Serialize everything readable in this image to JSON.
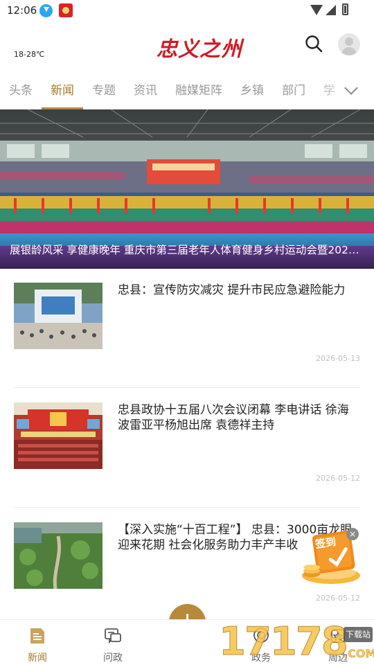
{
  "status_bar": {
    "time": "12:06",
    "icons": [
      "download-icon",
      "app-notification-icon",
      "wifi-icon",
      "signal-icon",
      "battery-icon"
    ]
  },
  "header": {
    "weather": "18-28℃",
    "logo_text": "忠义之州",
    "search_icon": "search-icon",
    "avatar_icon": "user-avatar-icon"
  },
  "tabs": {
    "items": [
      {
        "label": "头条",
        "active": false
      },
      {
        "label": "新闻",
        "active": true
      },
      {
        "label": "专题",
        "active": false
      },
      {
        "label": "资讯",
        "active": false
      },
      {
        "label": "融媒矩阵",
        "active": false
      },
      {
        "label": "乡镇",
        "active": false
      },
      {
        "label": "部门",
        "active": false
      },
      {
        "label": "学",
        "active": false
      }
    ],
    "more_icon": "chevron-down-icon",
    "active_color": "#a5782c"
  },
  "banner": {
    "caption": "展银龄风采 享健康晚年 重庆市第三届老年人体育健身乡村运动会暨2025…"
  },
  "news": [
    {
      "title": "忠县：宣传防灾减灾 提升市民应急避险能力",
      "date": "2026-05-13"
    },
    {
      "title": "忠县政协十五届八次会议闭幕 李电讲话 徐海波雷亚平杨旭出席 袁德祥主持",
      "date": "2026-05-12"
    },
    {
      "title": "【深入实施“十百工程”】 忠县：3000亩龙眼迎来花期 社会化服务助力丰产丰收",
      "date": "2026-05-12"
    }
  ],
  "signin_widget": {
    "label": "签到",
    "close": "×"
  },
  "bottom_nav": {
    "items": [
      {
        "label": "新闻",
        "icon": "news-icon",
        "active": true
      },
      {
        "label": "问政",
        "icon": "chat-icon",
        "active": false
      },
      {
        "label": "政务",
        "icon": "gov-icon",
        "active": false
      },
      {
        "label": "周边",
        "icon": "nearby-icon",
        "active": false
      }
    ],
    "fab_icon": "plus-icon"
  },
  "watermark": {
    "digits": "17178",
    "tag": "下载站",
    "domain": ".COM"
  },
  "colors": {
    "accent": "#b8893c",
    "brand_red": "#d01c25"
  }
}
